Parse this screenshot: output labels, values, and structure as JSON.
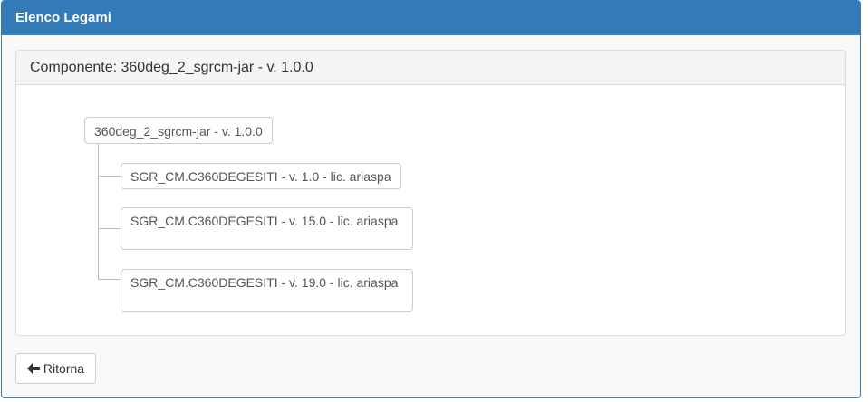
{
  "panel": {
    "title": "Elenco Legami"
  },
  "component": {
    "heading": "Componente: 360deg_2_sgrcm-jar - v. 1.0.0"
  },
  "tree": {
    "root": "360deg_2_sgrcm-jar - v. 1.0.0",
    "children": [
      "SGR_CM.C360DEGESITI - v. 1.0 - lic. ariaspa",
      "SGR_CM.C360DEGESITI - v. 15.0 - lic. ariaspa",
      "SGR_CM.C360DEGESITI - v. 19.0 - lic. ariaspa"
    ]
  },
  "actions": {
    "back_label": "Ritorna",
    "back_icon": "arrow-left-icon"
  },
  "colors": {
    "primary": "#337ab7",
    "border": "#dddddd",
    "text": "#333333"
  }
}
